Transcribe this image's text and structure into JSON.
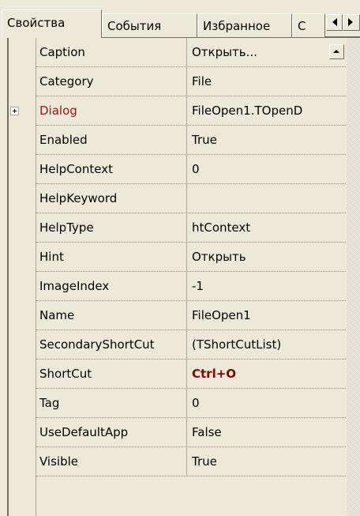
{
  "tabs": [
    {
      "label": "Свойства",
      "active": true
    },
    {
      "label": "События",
      "active": false
    },
    {
      "label": "Избранное",
      "active": false
    },
    {
      "label": "С",
      "active": false
    }
  ],
  "properties": [
    {
      "name": "Caption",
      "value": "Открыть..."
    },
    {
      "name": "Category",
      "value": "File"
    },
    {
      "name": "Dialog",
      "value": "FileOpen1.TOpenD"
    },
    {
      "name": "Enabled",
      "value": "True"
    },
    {
      "name": "HelpContext",
      "value": "0"
    },
    {
      "name": "HelpKeyword",
      "value": ""
    },
    {
      "name": "HelpType",
      "value": "htContext"
    },
    {
      "name": "Hint",
      "value": "Открыть"
    },
    {
      "name": "ImageIndex",
      "value": "-1"
    },
    {
      "name": "Name",
      "value": "FileOpen1"
    },
    {
      "name": "SecondaryShortCut",
      "value": "(TShortCutList)"
    },
    {
      "name": "ShortCut",
      "value": "Ctrl+O"
    },
    {
      "name": "Tag",
      "value": "0"
    },
    {
      "name": "UseDefaultApp",
      "value": "False"
    },
    {
      "name": "Visible",
      "value": "True"
    }
  ],
  "colors": {
    "subcomponent_name": "#a31515",
    "modified_value": "#8b0000"
  }
}
